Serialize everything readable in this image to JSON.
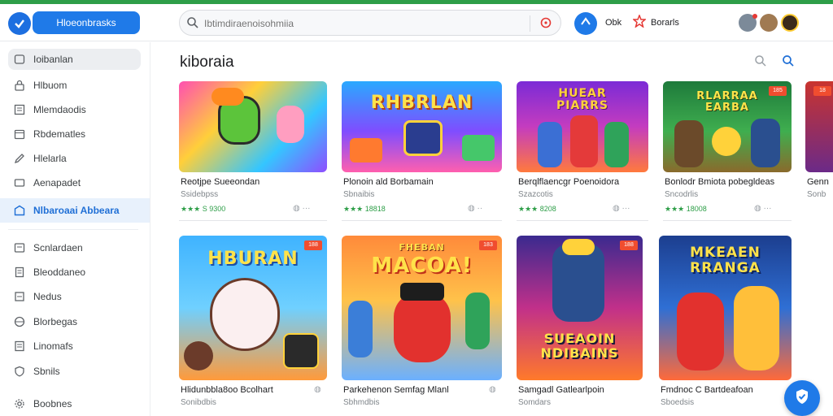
{
  "header": {
    "app_name": "Hloeonbrasks",
    "search_placeholder": "Ibtimdiraenoisohmiia",
    "action1_label": "Obk",
    "action2_label": "Borarls"
  },
  "sidebar": {
    "items": [
      {
        "label": "Ioibanlan",
        "icon": "home-icon"
      },
      {
        "label": "Hlbuom",
        "icon": "lock-icon"
      },
      {
        "label": "Mlemdaodis",
        "icon": "grid-icon"
      },
      {
        "label": "Rbdematles",
        "icon": "calendar-icon"
      },
      {
        "label": "Hlelarla",
        "icon": "edit-icon"
      },
      {
        "label": "Aenapadet",
        "icon": "apps-icon"
      },
      {
        "label": "Nlbaroaai Abbeara",
        "icon": "store-icon"
      },
      {
        "label": "Scnlardaen",
        "icon": "library-icon"
      },
      {
        "label": "Bleoddaneo",
        "icon": "document-icon"
      },
      {
        "label": "Nedus",
        "icon": "note-icon"
      },
      {
        "label": "Blorbegas",
        "icon": "globe-icon"
      },
      {
        "label": "Linomafs",
        "icon": "list-icon"
      },
      {
        "label": "Sbnils",
        "icon": "shield-icon"
      },
      {
        "label": "Boobnes",
        "icon": "settings-icon"
      }
    ]
  },
  "main": {
    "title": "kiboraia",
    "row1": [
      {
        "name": "Reotjpe Sueeondan",
        "sub": "Ssidebpss",
        "rating": "★★★ S 9300",
        "thumb_title": "",
        "badge": ""
      },
      {
        "name": "Plonoin ald Borbamain",
        "sub": "Sbnaibis",
        "rating": "★★★ 18818",
        "thumb_title": "RHBRLAN",
        "badge": ""
      },
      {
        "name": "Berqlflaencgr Poenoidora",
        "sub": "Szazcotis",
        "rating": "★★★ 8208",
        "thumb_title": "HUEAR PIARRS",
        "badge": ""
      },
      {
        "name": "Bonlodr Bmiota pobegldeas",
        "sub": "Sncodrlis",
        "rating": "★★★ 18008",
        "thumb_title": "RLARRAA EARBA",
        "badge": "185"
      },
      {
        "name": "Genn",
        "sub": "Sonb",
        "rating": "",
        "thumb_title": "",
        "badge": "18"
      }
    ],
    "row2": [
      {
        "name": "Hlidunbbla8oo Bcolhart",
        "sub": "Sonibdbis",
        "thumb_title": "HBURAN",
        "badge": "188"
      },
      {
        "name": "Parkehenon Semfag Mlanl",
        "sub": "Sbhmdbis",
        "thumb_title": "MACOA!",
        "thumb_over": "FHEBAN",
        "badge": "183"
      },
      {
        "name": "Samgadl Gatlearlpoin",
        "sub": "Somdars",
        "thumb_title": "SUEAOIN NDIBAINS",
        "badge": "188"
      },
      {
        "name": "Fmdnoc C Bartdeafoan",
        "sub": "Sboedsis",
        "thumb_title": "MKEAEN RRANGA",
        "badge": ""
      }
    ]
  },
  "colors": {
    "accent": "#1f7ae8",
    "brand_green": "#2e9e48",
    "badge": "#f04d2f"
  }
}
